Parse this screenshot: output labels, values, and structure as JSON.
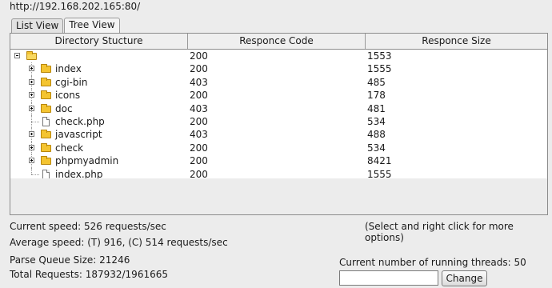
{
  "url": "http://192.168.202.165:80/",
  "tabs": [
    "List View",
    "Tree View"
  ],
  "table": {
    "headers": [
      "Directory Stucture",
      "Responce Code",
      "Responce Size"
    ],
    "rows": [
      {
        "name": "",
        "code": "200",
        "size": "1553",
        "type": "root-folder"
      },
      {
        "name": "index",
        "code": "200",
        "size": "1555",
        "type": "folder"
      },
      {
        "name": "cgi-bin",
        "code": "403",
        "size": "485",
        "type": "folder"
      },
      {
        "name": "icons",
        "code": "200",
        "size": "178",
        "type": "folder"
      },
      {
        "name": "doc",
        "code": "403",
        "size": "481",
        "type": "folder"
      },
      {
        "name": "check.php",
        "code": "200",
        "size": "534",
        "type": "file"
      },
      {
        "name": "javascript",
        "code": "403",
        "size": "488",
        "type": "folder"
      },
      {
        "name": "check",
        "code": "200",
        "size": "534",
        "type": "folder"
      },
      {
        "name": "phpmyadmin",
        "code": "200",
        "size": "8421",
        "type": "folder"
      },
      {
        "name": "index.php",
        "code": "200",
        "size": "1555",
        "type": "file"
      }
    ]
  },
  "status": {
    "current_speed": "Current speed: 526 requests/sec",
    "hint": "(Select and right click for more options)",
    "average_speed": "Average speed: (T) 916, (C) 514 requests/sec",
    "parse_queue": "Parse Queue Size: 21246",
    "total_requests": "Total Requests: 187932/1961665",
    "threads_label": "Current number of running threads: 50"
  },
  "threads_input": {
    "value": ""
  },
  "change_button": "Change",
  "icons": {
    "expander": "tree-expander-icon",
    "folder": "folder-icon",
    "file": "file-icon"
  },
  "colors": {
    "background": "#ececec",
    "folder": "#f4c430"
  }
}
